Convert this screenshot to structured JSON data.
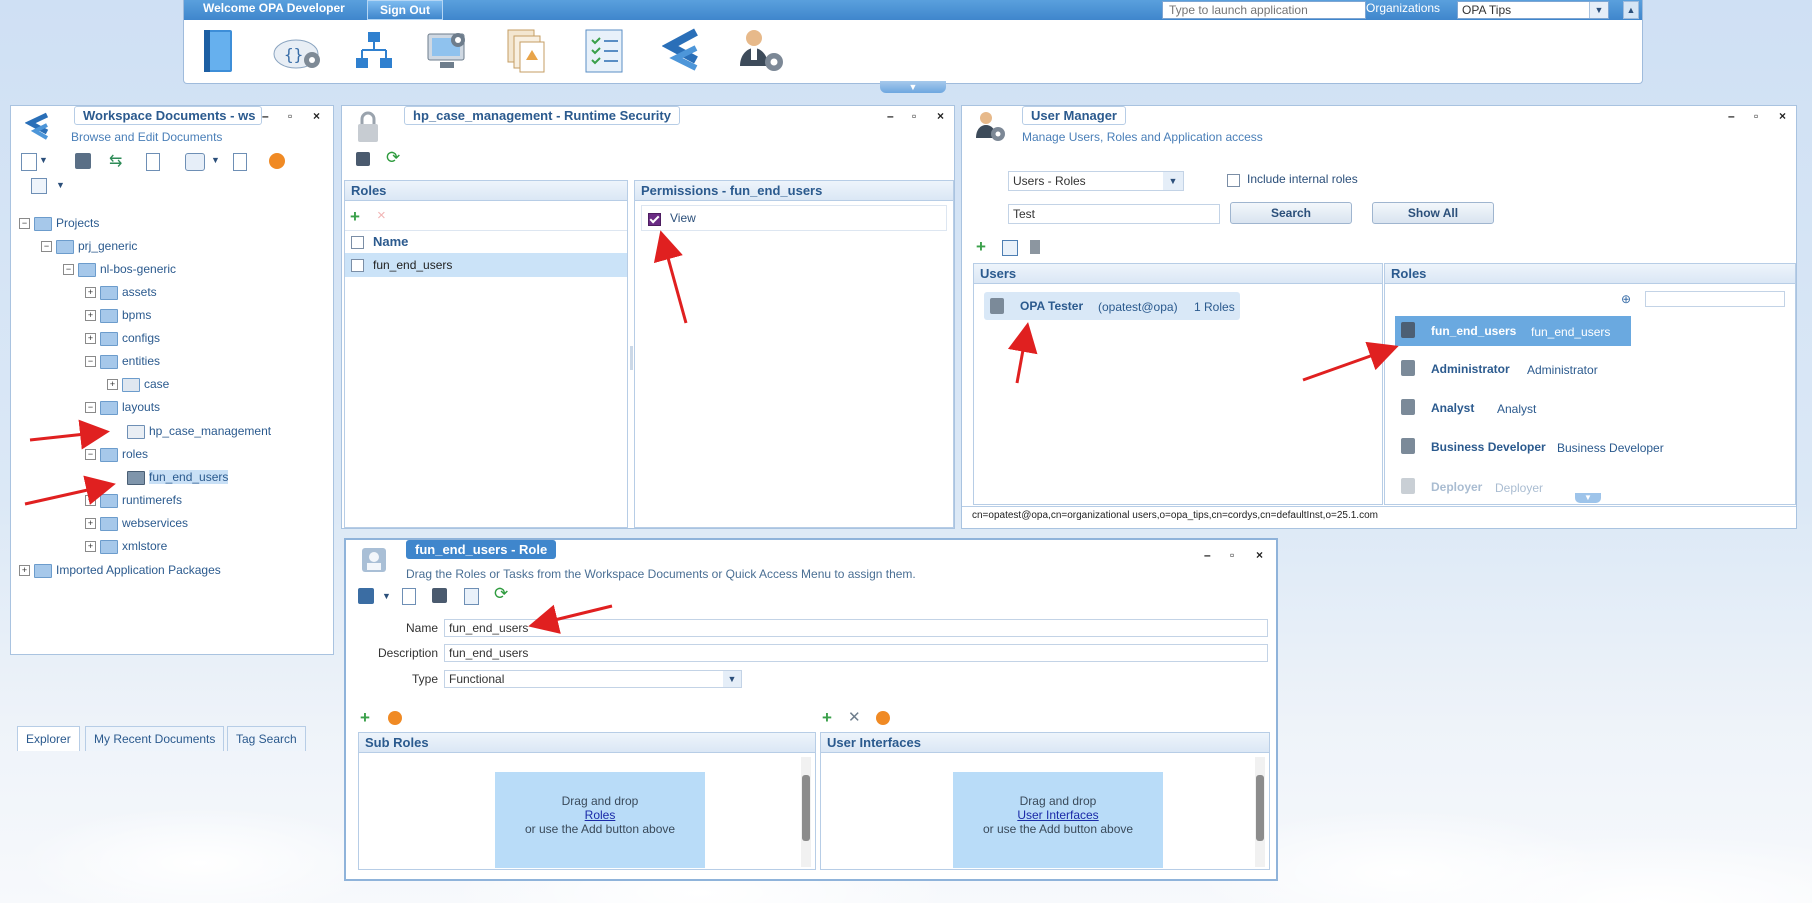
{
  "top": {
    "welcome": "Welcome OPA Developer",
    "signout": "Sign Out",
    "launch_placeholder": "Type to launch application",
    "org_label": "Organizations",
    "org_value": "OPA Tips",
    "toolbar_icons": [
      "book-icon",
      "code-settings-icon",
      "hierarchy-icon",
      "monitor-settings-icon",
      "documents-icon",
      "checklist-icon",
      "cordys-logo-icon",
      "user-settings-icon"
    ]
  },
  "workspace": {
    "title": "Workspace Documents - ws",
    "subtitle": "Browse and Edit Documents",
    "tree": {
      "projects": "Projects",
      "prj_generic": "prj_generic",
      "nl_bos": "nl-bos-generic",
      "assets": "assets",
      "bpms": "bpms",
      "configs": "configs",
      "entities": "entities",
      "case": "case",
      "layouts": "layouts",
      "hp_case": "hp_case_management",
      "roles": "roles",
      "fun_end_users": "fun_end_users",
      "runtimerefs": "runtimerefs",
      "webservices": "webservices",
      "xmlstore": "xmlstore",
      "imported": "Imported Application Packages"
    },
    "tabs": [
      "Explorer",
      "My Recent Documents",
      "Tag Search"
    ]
  },
  "security": {
    "title": "hp_case_management - Runtime Security",
    "roles_header": "Roles",
    "name_col": "Name",
    "role_row": "fun_end_users",
    "perm_header": "Permissions - fun_end_users",
    "perm_view": "View"
  },
  "usermgr": {
    "title": "User Manager",
    "subtitle": "Manage Users, Roles and Application access",
    "filter_value": "Users - Roles",
    "include_internal": "Include internal roles",
    "search_value": "Test",
    "search_btn": "Search",
    "showall_btn": "Show All",
    "users_header": "Users",
    "roles_header": "Roles",
    "user": {
      "name": "OPA Tester",
      "id": "(opatest@opa)",
      "roles": "1 Roles"
    },
    "roles": [
      {
        "name": "fun_end_users",
        "desc": "fun_end_users"
      },
      {
        "name": "Administrator",
        "desc": "Administrator"
      },
      {
        "name": "Analyst",
        "desc": "Analyst"
      },
      {
        "name": "Business Developer",
        "desc": "Business Developer"
      },
      {
        "name": "Deployer",
        "desc": "Deployer"
      }
    ],
    "dn": "cn=opatest@opa,cn=organizational users,o=opa_tips,cn=cordys,cn=defaultInst,o=25.1.com"
  },
  "role": {
    "title": "fun_end_users - Role",
    "subtitle": "Drag the Roles or Tasks from the Workspace Documents or Quick Access Menu to assign them.",
    "name_label": "Name",
    "name_value": "fun_end_users",
    "desc_label": "Description",
    "desc_value": "fun_end_users",
    "type_label": "Type",
    "type_value": "Functional",
    "subroles_header": "Sub Roles",
    "ui_header": "User Interfaces",
    "drag_line1": "Drag and drop",
    "drag_roles": "Roles",
    "drag_ui": "User Interfaces",
    "drag_line3": "or use the Add button above"
  },
  "colors": {
    "accent": "#3f86cc",
    "arrow": "#e02020",
    "selected": "#6aa9e0"
  }
}
